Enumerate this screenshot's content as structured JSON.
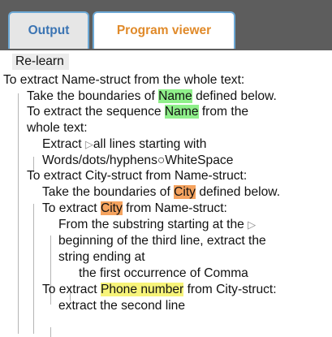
{
  "tabs": {
    "output": "Output",
    "viewer": "Program viewer"
  },
  "relearn_label": "Re-learn",
  "program": {
    "l1": "To extract Name-struct from the whole text:",
    "l2": {
      "pre": "Take the boundaries of ",
      "hl": "Name",
      "post": " defined below."
    },
    "l3": {
      "pre": "To extract the sequence ",
      "hl": "Name",
      "post": " from the"
    },
    "l4": "whole text:",
    "l5": {
      "pre": "Extract ",
      "tri": "▷",
      "post": "all lines starting with"
    },
    "l6": {
      "pre": "Words/dots/hyphens",
      "circle": "○",
      "post": "WhiteSpace"
    },
    "l7": "To extract City-struct from Name-struct:",
    "l8": {
      "pre": "Take the boundaries of ",
      "hl": "City",
      "post": " defined below."
    },
    "l9": {
      "pre": "To extract ",
      "hl": "City",
      "post": " from Name-struct:"
    },
    "l10": {
      "pre": "From the substring starting at the ",
      "tri": "▷"
    },
    "l11": "beginning of the third line, extract the",
    "l12": "string ending at",
    "l13": "the first occurrence of Comma",
    "l14": {
      "pre": "To extract ",
      "hl": "Phone number",
      "post": " from City-struct:"
    },
    "l15": "extract the second line"
  },
  "colors": {
    "tabbar": "#5d5d5d",
    "tab_border": "#6da9d6",
    "output_tab_text": "#3b74b3",
    "viewer_tab_text": "#e08a2a",
    "highlight_name": "#8ff08a",
    "highlight_city": "#f5a35f",
    "highlight_phone": "#f7f47a"
  }
}
